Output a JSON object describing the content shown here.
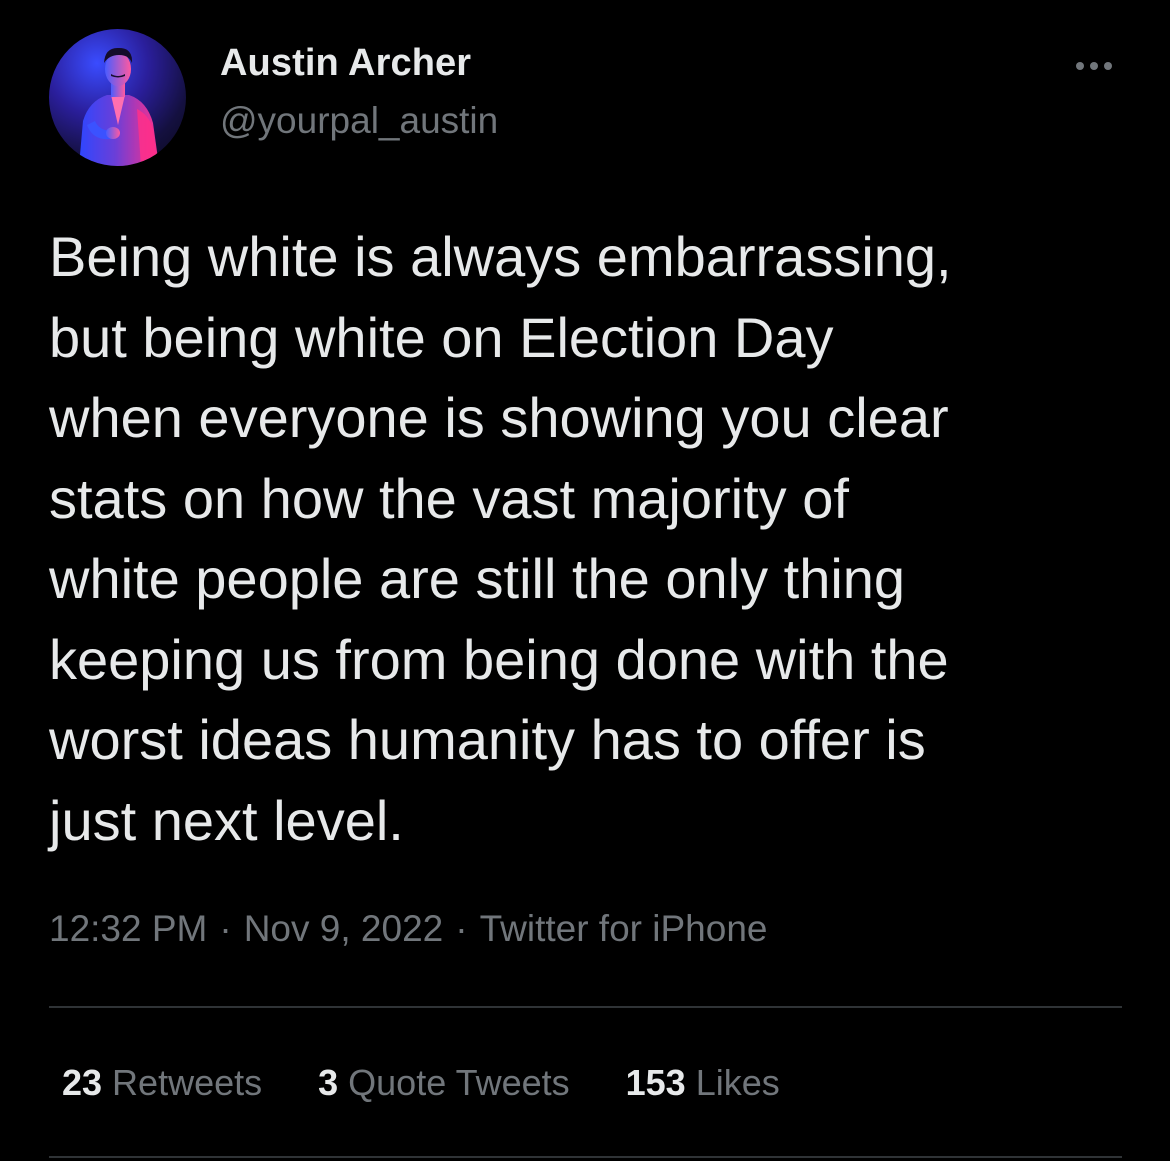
{
  "author": {
    "display_name": "Austin Archer",
    "handle": "@yourpal_austin"
  },
  "more_button": {
    "icon": "more-horizontal-icon"
  },
  "tweet": {
    "lines": [
      "Being white is always embarrassing,",
      "but being white on Election Day",
      "when everyone is showing you clear",
      "stats on how the vast majority of",
      "white people are still the only thing",
      "keeping us from being done with the",
      "worst ideas humanity has to offer is",
      "just next level."
    ]
  },
  "meta": {
    "time": "12:32 PM",
    "separator": "·",
    "date": "Nov 9, 2022",
    "source": "Twitter for iPhone"
  },
  "stats": {
    "retweets": {
      "count": "23",
      "label": "Retweets"
    },
    "quote_tweets": {
      "count": "3",
      "label": "Quote Tweets"
    },
    "likes": {
      "count": "153",
      "label": "Likes"
    }
  },
  "colors": {
    "background": "#000000",
    "primary_text": "#e7e9ea",
    "secondary_text": "#71767b",
    "divider": "#2f3336",
    "avatar_accent_pink": "#ff2f8a",
    "avatar_accent_blue": "#3a4cff"
  }
}
